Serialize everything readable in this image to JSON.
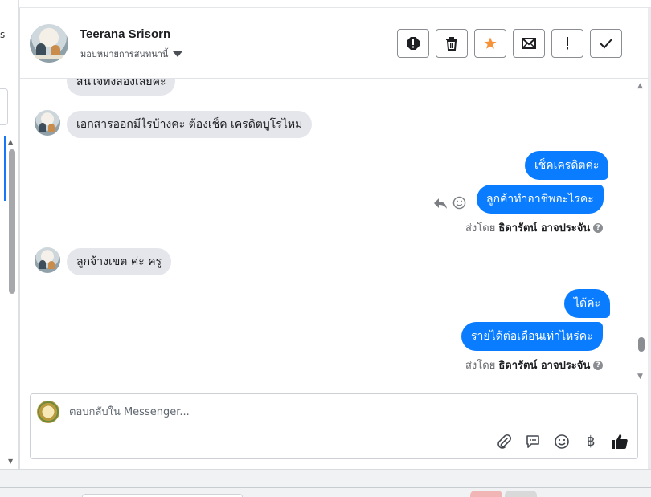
{
  "sidebar": {
    "edge_text": "s"
  },
  "header": {
    "contact_name": "Teerana Srisorn",
    "assign_label": "มอบหมายการสนทนานี้",
    "actions": [
      "spam-report",
      "delete",
      "star",
      "mark-unread",
      "follow-up",
      "done"
    ]
  },
  "messages": {
    "partial_top": "สนใจทั้งสองเลยคะ",
    "m1": "เอกสารออกมีไรบ้างคะ ต้องเช็ค เครดิตบูโรไหม",
    "m2": "เช็คเครดิตค่ะ",
    "m3": "ลูกค้าทำอาชีพอะไรคะ",
    "sent_by_label_1": "ส่งโดย",
    "sent_by_name_1": "ธิดารัตน์ อาจประจัน",
    "m4": "ลูกจ้างเขต ค่ะ ครู",
    "m5": "ได้ค่ะ",
    "m6": "รายได้ต่อเดือนเท่าไหร่คะ",
    "sent_by_label_2": "ส่งโดย",
    "sent_by_name_2": "ธิดารัตน์ อาจประจัน",
    "help_glyph": "?"
  },
  "composer": {
    "placeholder": "ตอบกลับใน Messenger...",
    "value": "",
    "currency_symbol": "฿",
    "tools": [
      "attach-icon",
      "quick-reply-icon",
      "emoji-icon",
      "payment-icon",
      "like-icon"
    ]
  },
  "colors": {
    "outgoing_bubble": "#0a7cff",
    "incoming_bubble": "#e4e6eb",
    "star": "#f7923b",
    "accent": "#1877f2"
  }
}
